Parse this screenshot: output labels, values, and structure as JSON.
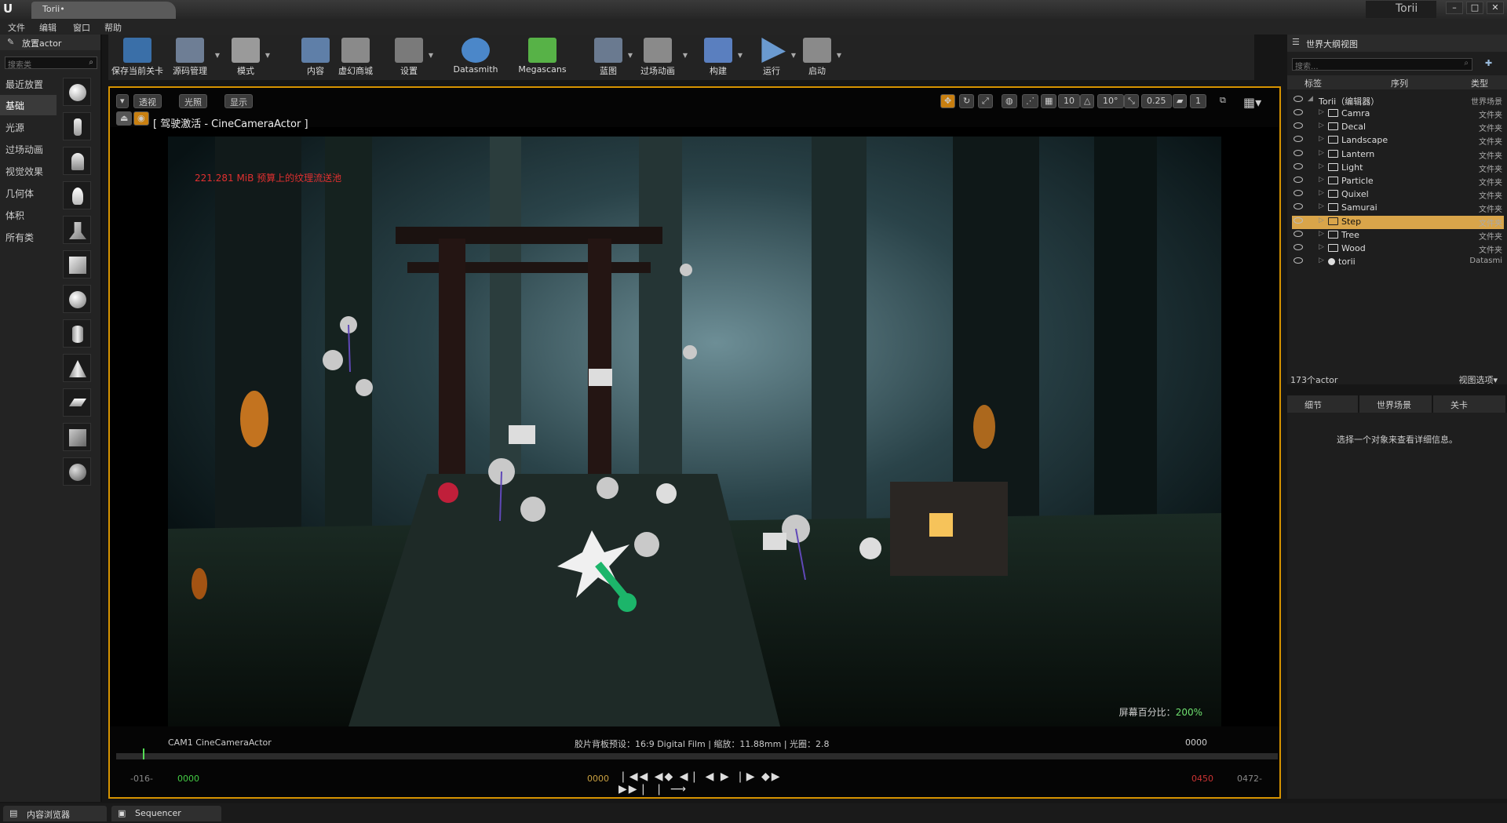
{
  "window": {
    "doc_tab": "Torii•",
    "project_name": "Torii",
    "min": "–",
    "max": "□",
    "close": "✕"
  },
  "menu": [
    "文件",
    "编辑",
    "窗口",
    "帮助"
  ],
  "place_actors": {
    "title": "放置actor",
    "search_placeholder": "搜索类",
    "categories": [
      "最近放置",
      "基础",
      "光源",
      "过场动画",
      "视觉效果",
      "几何体",
      "体积",
      "所有类"
    ],
    "active_category": "基础"
  },
  "toolbar": [
    {
      "label": "保存当前关卡",
      "icon": "save-icon",
      "color": "#3a6fa8"
    },
    {
      "label": "源码管理",
      "icon": "source-control-icon",
      "color": "#6e7e95"
    },
    {
      "label": "模式",
      "icon": "modes-icon",
      "color": "#9a9a9a"
    },
    {
      "label": "内容",
      "icon": "content-icon",
      "color": "#5f7fa8"
    },
    {
      "label": "虚幻商城",
      "icon": "marketplace-icon",
      "color": "#8a8a8a"
    },
    {
      "label": "设置",
      "icon": "settings-icon",
      "color": "#7a7a7a"
    },
    {
      "label": "Datasmith",
      "icon": "datasmith-icon",
      "color": "#4b87c9"
    },
    {
      "label": "Megascans",
      "icon": "megascans-icon",
      "color": "#57b247"
    },
    {
      "label": "蓝图",
      "icon": "blueprint-icon",
      "color": "#6a7a90"
    },
    {
      "label": "过场动画",
      "icon": "cinematics-icon",
      "color": "#8a8a8a"
    },
    {
      "label": "构建",
      "icon": "build-icon",
      "color": "#5a7fbf"
    },
    {
      "label": "运行",
      "icon": "play-icon",
      "color": "#6a9ad0"
    },
    {
      "label": "启动",
      "icon": "launch-icon",
      "color": "#8a8a8a"
    }
  ],
  "viewport": {
    "perspective_btn": "透视",
    "lit_btn": "光照",
    "show_btn": "显示",
    "grid_snap": "10",
    "rotation_snap": "10°",
    "scale_snap": "0.25",
    "camera_speed": "1",
    "pilot_label": "[ 驾驶激活 - CineCameraActor ]",
    "warning": "221.281 MiB 预算上的纹理流送池",
    "screen_pct_label": "屏幕百分比：",
    "screen_pct_value": "200%",
    "camera_name": "CAM1  CineCameraActor",
    "film_info": "胶片背板预设：16:9 Digital Film | 缩放：11.88mm | 光圈：2.8",
    "frame_current": "0000",
    "range_start": "-016-",
    "range_start_green": "0000",
    "play_start": "0000",
    "play_end": "0450",
    "range_end": "0472-",
    "transport": "❘◀◀ ◀◆ ◀❘ ◀ ▶ ❘▶ ◆▶ ▶▶❘ ❘ ⟶"
  },
  "outliner": {
    "tab": "世界大纲视图",
    "search_placeholder": "搜索...",
    "col_label": "标签",
    "col_sequence": "序列",
    "col_type": "类型",
    "root": {
      "name": "Torii（编辑器）",
      "type": "世界场景"
    },
    "rows": [
      {
        "name": "Camra",
        "type": "文件夹"
      },
      {
        "name": "Decal",
        "type": "文件夹"
      },
      {
        "name": "Landscape",
        "type": "文件夹"
      },
      {
        "name": "Lantern",
        "type": "文件夹"
      },
      {
        "name": "Light",
        "type": "文件夹"
      },
      {
        "name": "Particle",
        "type": "文件夹"
      },
      {
        "name": "Quixel",
        "type": "文件夹"
      },
      {
        "name": "Samurai",
        "type": "文件夹"
      },
      {
        "name": "Step",
        "type": "文件夹"
      },
      {
        "name": "Tree",
        "type": "文件夹"
      },
      {
        "name": "Wood",
        "type": "文件夹"
      },
      {
        "name": "torii",
        "type": "Datasmi"
      }
    ],
    "selected": "Step",
    "actor_count": "173个actor",
    "view_options": "视图选项▾"
  },
  "details": {
    "tabs": [
      "细节",
      "世界场景",
      "关卡"
    ],
    "message": "选择一个对象来查看详细信息。"
  },
  "bottom_tabs": [
    "内容浏览器",
    "Sequencer"
  ],
  "colors": {
    "accent": "#d69300",
    "selection": "#d9a54a"
  }
}
